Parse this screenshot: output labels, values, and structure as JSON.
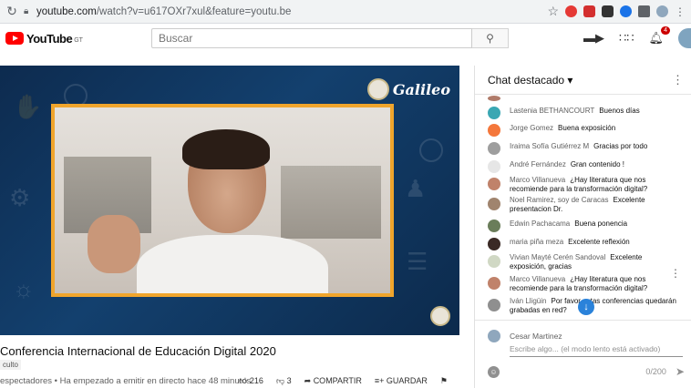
{
  "browser": {
    "url_main": "youtube.com",
    "url_rest": "/watch?v=u617OXr7xul&feature=youtu.be"
  },
  "youtube": {
    "logo_text": "YouTube",
    "logo_country": "GT",
    "search_placeholder": "Buscar",
    "notifications_count": "4"
  },
  "video": {
    "overlay_brand": "Galileo",
    "title": "Conferencia Internacional de Educación Digital 2020",
    "tag": "culto",
    "meta": "espectadores • Ha empezado a emitir en directo hace 48 minutos",
    "likes": "216",
    "dislikes": "3",
    "share_label": "COMPARTIR",
    "save_label": "GUARDAR"
  },
  "chat": {
    "header": "Chat destacado",
    "messages": [
      {
        "author": "Lastenia BETHANCOURT",
        "text": "Buenos días",
        "color": "#3aa7b3"
      },
      {
        "author": "Jorge Gomez",
        "text": "Buena exposición",
        "color": "#f4773b"
      },
      {
        "author": "Iraima Sofía Gutiérrez M",
        "text": "Gracias por todo",
        "color": "#9e9e9e"
      },
      {
        "author": "André Fernández",
        "text": "Gran contenido !",
        "color": "#e6e6e6"
      },
      {
        "author": "Marco Villanueva",
        "text": "¿Hay literatura que nos recomiende para la transformación digital?",
        "color": "#c0826a"
      },
      {
        "author": "Noel Ramirez, soy de Caracas",
        "text": "Excelente presentacion Dr.",
        "color": "#a0846e"
      },
      {
        "author": "Edwin Pachacama",
        "text": "Buena ponencia",
        "color": "#6a7d5a"
      },
      {
        "author": "maria piña meza",
        "text": "Excelente reflexión",
        "color": "#3a2a25"
      },
      {
        "author": "Vivian Mayté Cerén Sandoval",
        "text": "Excelente exposición, gracias",
        "color": "#d0d8c4"
      },
      {
        "author": "Marco Villanueva",
        "text": "¿Hay literatura que nos recomiende para la transformación digital?",
        "color": "#c0826a"
      },
      {
        "author": "Iván Lligüin",
        "text": "Por favor estas conferencias quedarán grabadas en red?",
        "color": "#8f8f8f"
      }
    ],
    "composer_user": "Cesar Martinez",
    "composer_placeholder": "Escribe algo... (el modo lento está activado)",
    "char_count": "0/200"
  }
}
